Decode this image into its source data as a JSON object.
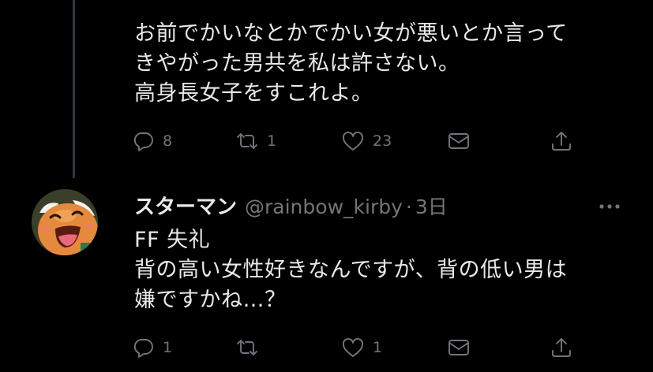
{
  "tweet1": {
    "text": "お前でかいなとかでかい女が悪いとか言って\nきやがった男共を私は許さない。\n高身長女子をすこれよ。",
    "reply_count": "8",
    "retweet_count": "1",
    "like_count": "23"
  },
  "tweet2": {
    "display_name": "スターマン",
    "handle": "@rainbow_kirby",
    "separator": "·",
    "time": "3日",
    "text": "FF 失礼\n背の高い女性好きなんですが、背の低い男は\n嫌ですかね…？",
    "reply_count": "1",
    "retweet_count": "",
    "like_count": "1"
  },
  "icons": [
    "reply-icon",
    "retweet-icon",
    "like-icon",
    "dm-icon",
    "share-icon",
    "more-icon"
  ],
  "colors": {
    "background": "#000000",
    "text": "#e7e9ea",
    "muted": "#71767b",
    "thread_line": "#333639"
  }
}
